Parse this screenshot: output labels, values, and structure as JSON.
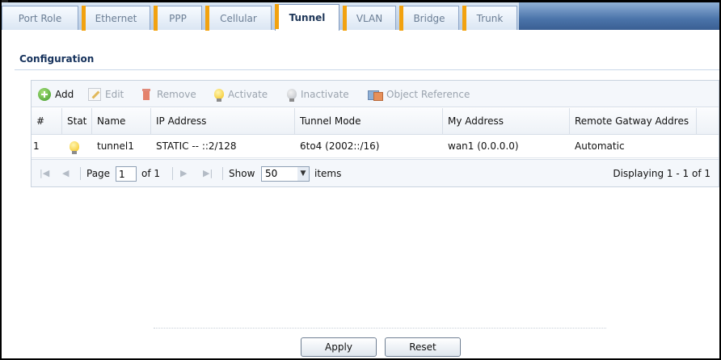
{
  "tabs": [
    {
      "label": "Port Role",
      "active": false
    },
    {
      "label": "Ethernet",
      "active": false
    },
    {
      "label": "PPP",
      "active": false
    },
    {
      "label": "Cellular",
      "active": false
    },
    {
      "label": "Tunnel",
      "active": true
    },
    {
      "label": "VLAN",
      "active": false
    },
    {
      "label": "Bridge",
      "active": false
    },
    {
      "label": "Trunk",
      "active": false
    }
  ],
  "section_title": "Configuration",
  "toolbar": {
    "add": "Add",
    "edit": "Edit",
    "remove": "Remove",
    "activate": "Activate",
    "inactivate": "Inactivate",
    "object_reference": "Object Reference"
  },
  "table": {
    "columns": [
      "#",
      "Stat",
      "Name",
      "IP Address",
      "Tunnel Mode",
      "My Address",
      "Remote Gatway Addres"
    ],
    "rows": [
      {
        "index": "1",
        "status": "bulb-on-icon",
        "name": "tunnel1",
        "ip_address": "STATIC -- ::2/128",
        "tunnel_mode": "6to4 (2002::/16)",
        "my_address": "wan1 (0.0.0.0)",
        "remote_gateway": "Automatic"
      }
    ]
  },
  "pager": {
    "page_label": "Page",
    "page_value": "1",
    "of_label": "of 1",
    "show_label": "Show",
    "show_value": "50",
    "items_label": "items",
    "displaying": "Displaying 1 - 1 of 1"
  },
  "buttons": {
    "apply": "Apply",
    "reset": "Reset"
  },
  "colors": {
    "tab_marker": "#f2a20f",
    "title_blue": "#16325c",
    "tabbar_blue": "#4b74aa"
  }
}
